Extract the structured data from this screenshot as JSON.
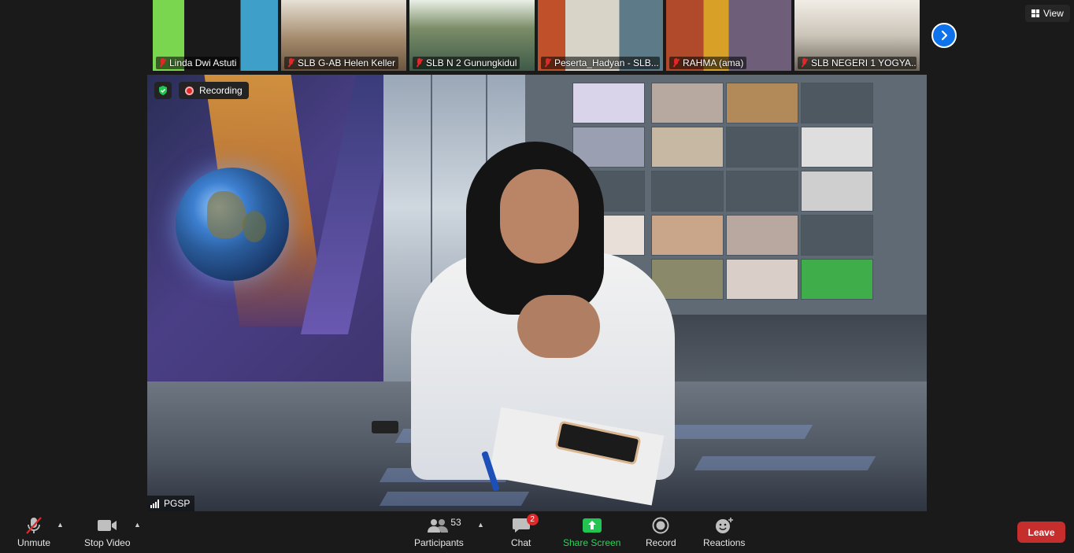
{
  "gallery": [
    {
      "name": "Linda Dwi Astuti",
      "bg": "#3a8c3a"
    },
    {
      "name": "SLB G-AB Helen Keller",
      "bg": "#b39a7a"
    },
    {
      "name": "SLB N 2 Gunungkidul",
      "bg": "#6f7f5f"
    },
    {
      "name": "Peserta_Hadyan - SLB...",
      "bg": "#c7c2b5"
    },
    {
      "name": "RAHMA (ama)",
      "bg": "#8a7a5f"
    },
    {
      "name": "SLB NEGERI 1 YOGYA...",
      "bg": "#c9c4ba"
    }
  ],
  "top": {
    "view_label": "View"
  },
  "main": {
    "recording_label": "Recording",
    "speaker_name": "PGSP"
  },
  "toolbar": {
    "unmute_label": "Unmute",
    "stop_video_label": "Stop Video",
    "participants_label": "Participants",
    "participants_count": "53",
    "chat_label": "Chat",
    "chat_badge": "2",
    "share_label": "Share Screen",
    "record_label": "Record",
    "reactions_label": "Reactions",
    "leave_label": "Leave"
  },
  "colors": {
    "accent_blue": "#0e72ed",
    "share_green": "#2ed15b",
    "leave_red": "#c62d2d",
    "muted_red": "#e02828"
  }
}
